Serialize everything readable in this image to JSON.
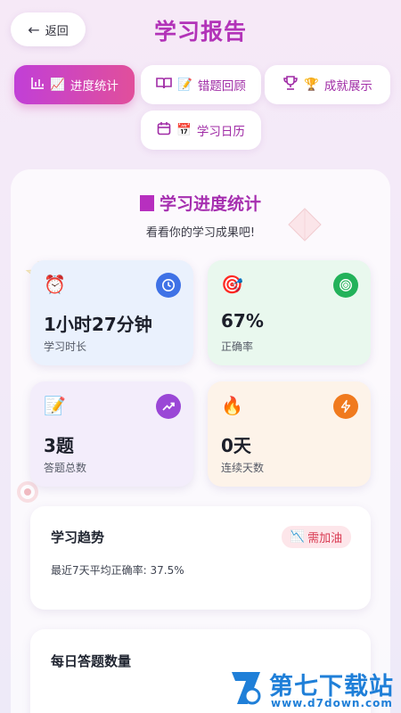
{
  "header": {
    "back_icon": "arrow-left-icon",
    "back_label": "返回",
    "title": "学习报告"
  },
  "tabs": [
    {
      "icon": "bar-chart-icon",
      "emoji": "📈",
      "label": "进度统计",
      "active": true
    },
    {
      "icon": "book-icon",
      "emoji": "📝",
      "label": "错题回顾",
      "active": false
    },
    {
      "icon": "trophy-icon",
      "emoji": "🏆",
      "label": "成就展示",
      "active": false
    },
    {
      "icon": "calendar-icon",
      "emoji": "📅",
      "label": "学习日历",
      "active": false
    }
  ],
  "section": {
    "title": "学习进度统计",
    "subtitle": "看看你的学习成果吧!"
  },
  "stats": [
    {
      "emoji": "⏰",
      "badge_icon": "clock-icon",
      "value": "1小时27分钟",
      "label": "学习时长",
      "color": "#3f72e6"
    },
    {
      "emoji": "🎯",
      "badge_icon": "target-icon",
      "value": "67%",
      "label": "正确率",
      "color": "#23b25a"
    },
    {
      "emoji": "📝",
      "badge_icon": "trending-up-icon",
      "value": "3题",
      "label": "答题总数",
      "color": "#9a47d6"
    },
    {
      "emoji": "🔥",
      "badge_icon": "lightning-icon",
      "value": "0天",
      "label": "连续天数",
      "color": "#f07a1e"
    }
  ],
  "trend": {
    "title": "学习趋势",
    "badge_emoji": "📉",
    "badge_label": "需加油",
    "note": "最近7天平均正确率: 37.5%"
  },
  "daily": {
    "title": "每日答题数量"
  },
  "watermark": {
    "brand": "第七下载站",
    "url": "www.d7down.com"
  },
  "colors": {
    "accent": "#b233b8",
    "tab_gradient_start": "#c13fd7",
    "tab_gradient_end": "#e14f9b",
    "warning": "#d93a52"
  }
}
